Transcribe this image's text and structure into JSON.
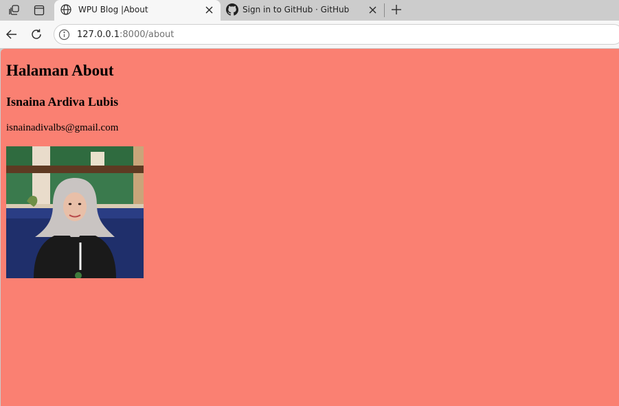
{
  "browser": {
    "tabs": [
      {
        "title": "WPU Blog |About",
        "active": true,
        "favicon": "globe-icon"
      },
      {
        "title": "Sign in to GitHub · GitHub",
        "active": false,
        "favicon": "github-icon"
      }
    ],
    "address": {
      "host": "127.0.0.1",
      "path": ":8000/about"
    }
  },
  "page": {
    "background_color": "#fa8072",
    "heading": "Halaman About",
    "name": "Isnaina Ardiva Lubis",
    "email": "isnainadivalbs@gmail.com",
    "photo_alt": "profile photo"
  }
}
